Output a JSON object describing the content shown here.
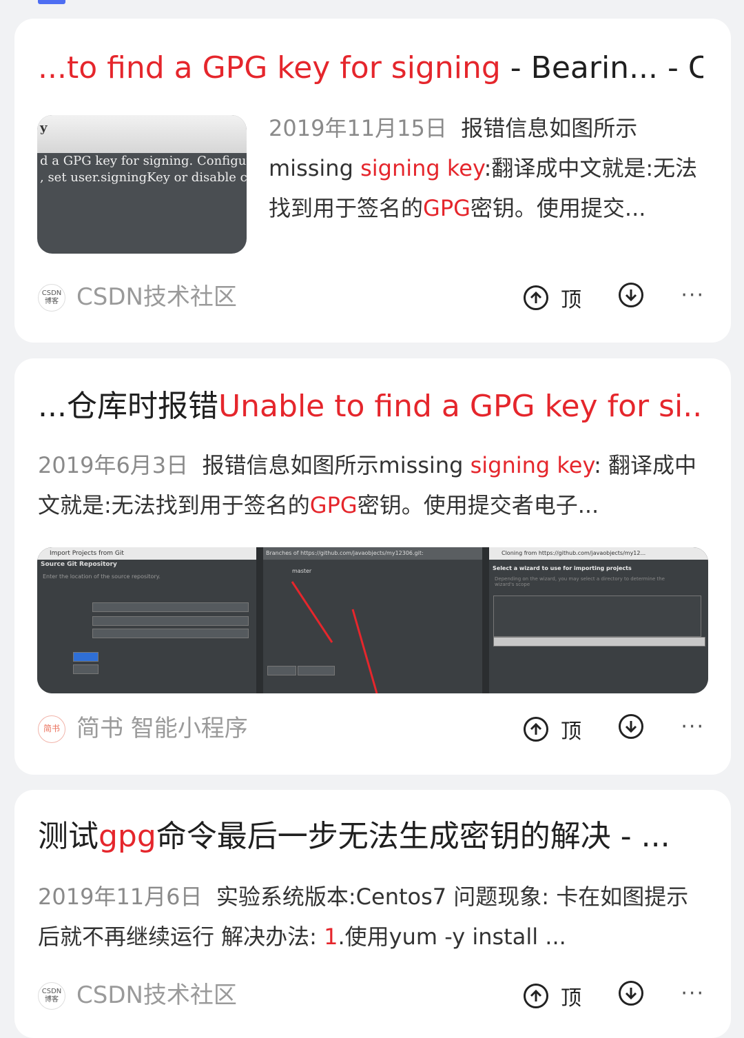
{
  "results": [
    {
      "title_parts": [
        {
          "text": "...to find a GPG key for signing",
          "hl": true
        },
        {
          "text": " - Bearin... - C...",
          "hl": false
        }
      ],
      "date": "2019年11月15日",
      "snippet_parts": [
        {
          "text": "报错信息如图所示missing ",
          "hl": false
        },
        {
          "text": "signing key",
          "hl": true
        },
        {
          "text": ":翻译成中文就是:无法找到用于签名的",
          "hl": false
        },
        {
          "text": "GPG",
          "hl": true
        },
        {
          "text": "密钥。使用提交...",
          "hl": false
        }
      ],
      "thumb_lines": [
        "y",
        "d a GPG key for signing. Configure GP",
        ", set user.signingKey or disable comr"
      ],
      "source_logo": "CSDN 博客",
      "source": "CSDN技术社区",
      "upvote_label": "顶",
      "downvote_icon": "circle-arrow-down",
      "more_label": "···"
    },
    {
      "title_parts": [
        {
          "text": "...仓库时报错",
          "hl": false
        },
        {
          "text": "Unable to find a GPG key for si...",
          "hl": true
        }
      ],
      "date": "2019年6月3日",
      "snippet_parts": [
        {
          "text": "报错信息如图所示missing ",
          "hl": false
        },
        {
          "text": "signing key",
          "hl": true
        },
        {
          "text": ": 翻译成中文就是:无法找到用于签名的",
          "hl": false
        },
        {
          "text": "GPG",
          "hl": true
        },
        {
          "text": "密钥。使用提交者电子...",
          "hl": false
        }
      ],
      "screens": [
        {
          "title": "Import Projects from Git",
          "heading": "Source Git Repository",
          "sub": "Enter the location of the source repository."
        },
        {
          "title": "Branches of https://github.com/javaobjects/my12306.git:",
          "heading": "master",
          "sub": ""
        },
        {
          "title": "Cloning from https://github.com/javaobjects/my12...",
          "heading": "Select a wizard to use for importing projects",
          "sub": "Depending on the wizard, you may select a directory to determine the wizard's scope"
        }
      ],
      "source_logo": "简书",
      "source": "简书  智能小程序",
      "upvote_label": "顶",
      "more_label": "···"
    },
    {
      "title_parts": [
        {
          "text": "测试",
          "hl": false
        },
        {
          "text": "gpg",
          "hl": true
        },
        {
          "text": "命令最后一步无法生成密钥的解决 - ...",
          "hl": false
        }
      ],
      "date": "2019年11月6日",
      "snippet_parts": [
        {
          "text": "实验系统版本:Centos7 问题现象: 卡在如图提示后就不再继续运行 解决办法: ",
          "hl": false
        },
        {
          "text": "1",
          "hl": true
        },
        {
          "text": ".使用yum -y install ...",
          "hl": false
        }
      ],
      "source_logo": "CSDN 博客",
      "source": "CSDN技术社区",
      "upvote_label": "顶",
      "more_label": "···"
    }
  ]
}
